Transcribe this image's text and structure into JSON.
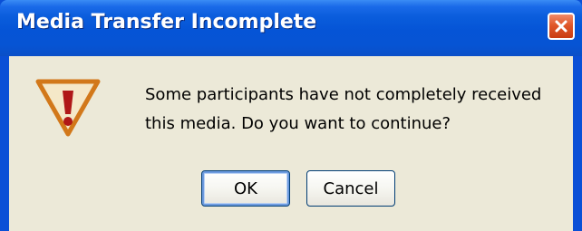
{
  "dialog": {
    "title": "Media Transfer Incomplete",
    "message_lines": [
      "Some participants have not completely received",
      "this media. Do you want to continue?"
    ],
    "icon": "warning-icon",
    "buttons": {
      "ok_label": "OK",
      "cancel_label": "Cancel"
    }
  },
  "colors": {
    "titlebar": "#0554d6",
    "window_body": "#ece9d8",
    "close_button": "#e0582a",
    "warning_stroke": "#d2781a",
    "warning_mark": "#b01818"
  }
}
